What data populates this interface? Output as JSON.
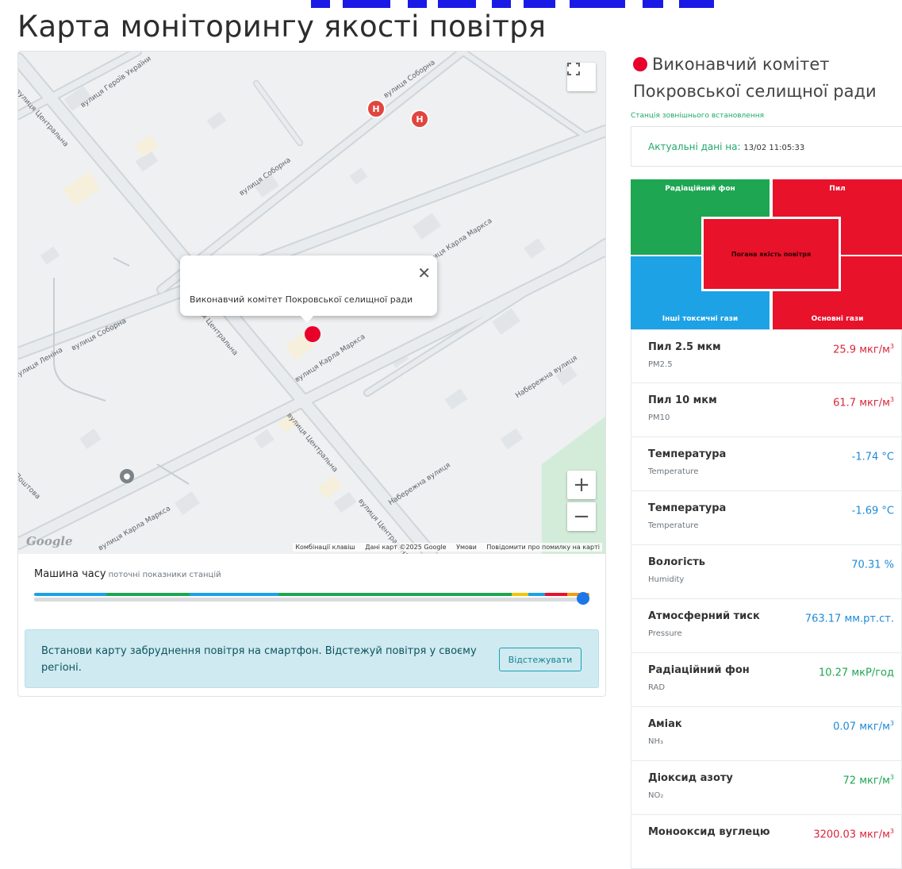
{
  "page": {
    "title": "Карта моніторингу якості повітря"
  },
  "map": {
    "streets": [
      "вулиця Центральна",
      "вулиця Героїв України",
      "вулиця Соборна",
      "вулиця Соборна",
      "вулиця Соборна",
      "вулиця Карла Маркса",
      "вулиця Карла Маркса",
      "вулиця Карла Маркса",
      "вулиця Центральна",
      "вулиця Центральна",
      "вулиця Центральна",
      "Набережна вулиця",
      "Набережна вулиця",
      "вулиця Леніна",
      "Поштова"
    ],
    "popup_text": "Виконавчий комітет Покровської селищної ради",
    "popup_close": "✕",
    "hospital_glyph": "H",
    "zoom_in": "+",
    "zoom_out": "−",
    "logo": "Google",
    "attribution": {
      "shortcuts": "Комбінації клавіш",
      "map_data": "Дані карт ©2025 Google",
      "terms": "Умови",
      "report": "Повідомити про помилку на карті"
    }
  },
  "time_machine": {
    "label": "Машина часу",
    "sublabel": "поточні показники станцій",
    "segments": [
      {
        "color": "#1da1e6",
        "share": 0.13
      },
      {
        "color": "#1ea652",
        "share": 0.15
      },
      {
        "color": "#1da1e6",
        "share": 0.16
      },
      {
        "color": "#1ea652",
        "share": 0.42
      },
      {
        "color": "#f1c40f",
        "share": 0.03
      },
      {
        "color": "#1da1e6",
        "share": 0.03
      },
      {
        "color": "#e8122b",
        "share": 0.04
      },
      {
        "color": "#f39c12",
        "share": 0.04
      }
    ]
  },
  "promo": {
    "text": "Встанови карту забруднення повітря на смартфон. Відстежуй повітря у своєму регіоні.",
    "button": "Відстежувати"
  },
  "station": {
    "name": "Виконавчий комітет Покровської селищної ради",
    "status_color": "#e8002a",
    "type": "Станція зовнішнього встановлення",
    "actual_label": "Актуальні дані на:",
    "actual_time": "13/02 11:05:33"
  },
  "quadrants": {
    "radiation": "Радіаційний фон",
    "dust": "Пил",
    "other_gases": "Інші токсичні гази",
    "main_gases": "Основні гази",
    "center": "Погана якість повітря"
  },
  "readings": [
    {
      "name": "Пил 2.5 мкм",
      "code": "PM2.5",
      "value": "25.9",
      "unit": "мкг/м",
      "sup": "3",
      "color": "#d9263a"
    },
    {
      "name": "Пил 10 мкм",
      "code": "PM10",
      "value": "61.7",
      "unit": "мкг/м",
      "sup": "3",
      "color": "#d9263a"
    },
    {
      "name": "Температура",
      "code": "Temperature",
      "value": "-1.74",
      "unit": "°C",
      "sup": "",
      "color": "#1f8ad6"
    },
    {
      "name": "Температура",
      "code": "Temperature",
      "value": "-1.69",
      "unit": "°C",
      "sup": "",
      "color": "#1f8ad6"
    },
    {
      "name": "Вологість",
      "code": "Humidity",
      "value": "70.31",
      "unit": "%",
      "sup": "",
      "color": "#1f8ad6"
    },
    {
      "name": "Атмосферний тиск",
      "code": "Pressure",
      "value": "763.17",
      "unit": "мм.рт.ст.",
      "sup": "",
      "color": "#1f8ad6"
    },
    {
      "name": "Радіаційний фон",
      "code": "RAD",
      "value": "10.27",
      "unit": "мкР/год",
      "sup": "",
      "color": "#1ea652"
    },
    {
      "name": "Аміак",
      "code": "NH₃",
      "value": "0.07",
      "unit": "мкг/м",
      "sup": "3",
      "color": "#1f8ad6"
    },
    {
      "name": "Діоксид азоту",
      "code": "NO₂",
      "value": "72",
      "unit": "мкг/м",
      "sup": "3",
      "color": "#1ea652"
    },
    {
      "name": "Монооксид вуглецю",
      "code": "",
      "value": "3200.03",
      "unit": "мкг/м",
      "sup": "3",
      "color": "#d9263a"
    }
  ]
}
